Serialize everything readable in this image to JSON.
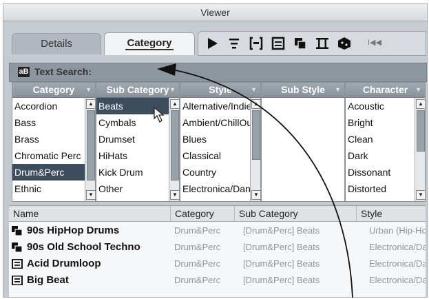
{
  "window": {
    "title": "Viewer"
  },
  "tabs": [
    {
      "label": "Details",
      "active": false
    },
    {
      "label": "Category",
      "active": true
    }
  ],
  "toolbar": {
    "icons": [
      "play-icon",
      "filter-icon",
      "bracket-icon",
      "list-icon",
      "copy-icon",
      "column-icon",
      "dice-icon",
      "rewind-icon"
    ],
    "rewind_label": "I◀◀"
  },
  "search": {
    "icon": "aB",
    "label": "Text Search:"
  },
  "columns": [
    {
      "header": "Category",
      "items": [
        "Accordion",
        "Bass",
        "Brass",
        "Chromatic Perc",
        "Drum&Perc",
        "Ethnic"
      ],
      "selected": 4
    },
    {
      "header": "Sub Category",
      "items": [
        "Beats",
        "Cymbals",
        "Drumset",
        "HiHats",
        "Kick Drum",
        "Other"
      ],
      "selected": 0
    },
    {
      "header": "Style",
      "items": [
        "Alternative/Indie",
        "Ambient/ChillOut",
        "Blues",
        "Classical",
        "Country",
        "Electronica/Dance"
      ],
      "selected": -1
    },
    {
      "header": "Sub Style",
      "items": [],
      "selected": -1
    },
    {
      "header": "Character",
      "items": [
        "Acoustic",
        "Bright",
        "Clean",
        "Dark",
        "Dissonant",
        "Distorted"
      ],
      "selected": -1
    }
  ],
  "results": {
    "headers": [
      "Name",
      "Category",
      "Sub Category",
      "Style"
    ],
    "rows": [
      {
        "icon": "pattern-icon",
        "name": "90s HipHop Drums",
        "category": "Drum&Perc",
        "subcategory": "[Drum&Perc] Beats",
        "style": "Urban (Hip-Hop)"
      },
      {
        "icon": "pattern-icon",
        "name": "90s Old School Techno",
        "category": "Drum&Perc",
        "subcategory": "[Drum&Perc] Beats",
        "style": "Electronica/Dance"
      },
      {
        "icon": "loop-icon",
        "name": "Acid Drumloop",
        "category": "Drum&Perc",
        "subcategory": "[Drum&Perc] Beats",
        "style": "Electronica/Dance"
      },
      {
        "icon": "loop-icon",
        "name": "Big Beat",
        "category": "Drum&Perc",
        "subcategory": "[Drum&Perc] Beats",
        "style": "Electronica/Dance"
      }
    ]
  },
  "colors": {
    "selection": "#3e4d5d",
    "header": "#8e979f",
    "accent": "#222222"
  }
}
